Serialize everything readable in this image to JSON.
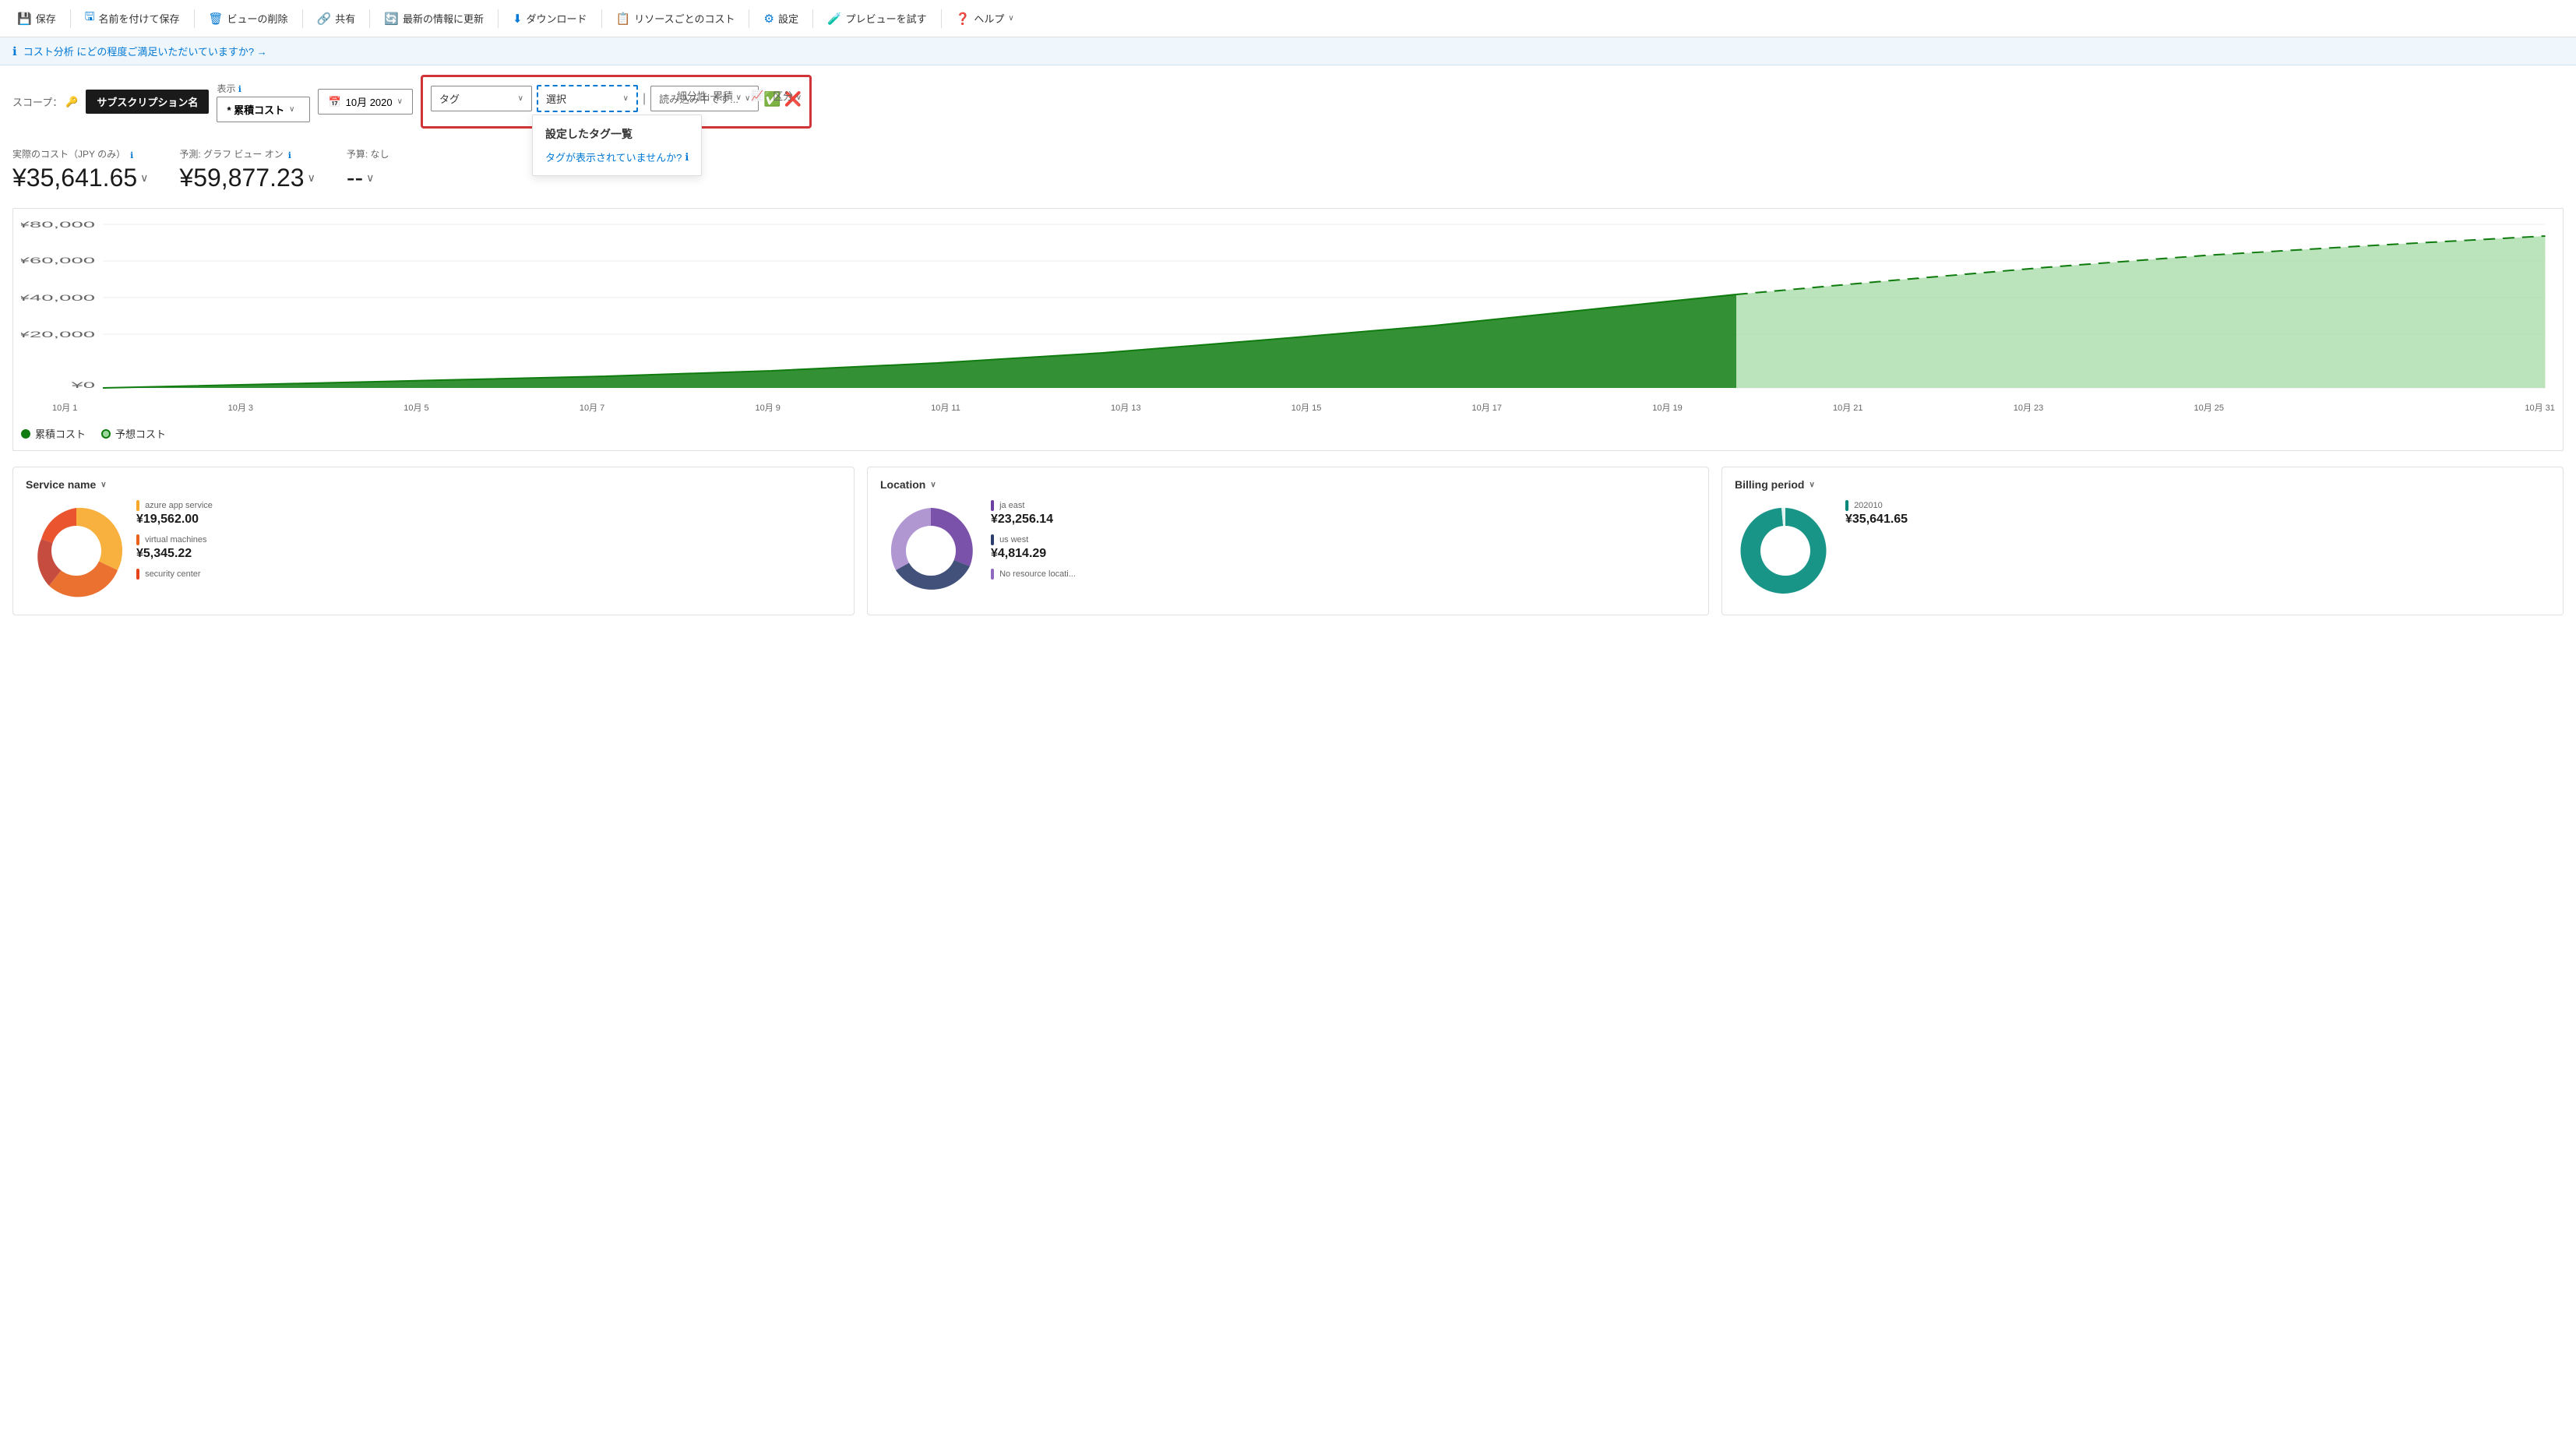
{
  "toolbar": {
    "buttons": [
      {
        "id": "save",
        "label": "保存",
        "icon": "💾"
      },
      {
        "id": "save-as",
        "label": "名前を付けて保存",
        "icon": "🖫"
      },
      {
        "id": "delete-view",
        "label": "ビューの削除",
        "icon": "🗑"
      },
      {
        "id": "share",
        "label": "共有",
        "icon": "🔗"
      },
      {
        "id": "refresh",
        "label": "最新の情報に更新",
        "icon": "🔄"
      },
      {
        "id": "download",
        "label": "ダウンロード",
        "icon": "⬇"
      },
      {
        "id": "resource-cost",
        "label": "リソースごとのコスト",
        "icon": "📋"
      },
      {
        "id": "settings",
        "label": "設定",
        "icon": "⚙"
      },
      {
        "id": "preview",
        "label": "プレビューを試す",
        "icon": "🧪"
      },
      {
        "id": "help",
        "label": "ヘルプ",
        "icon": "❓"
      }
    ]
  },
  "infobar": {
    "text": "コスト分析 にどの程度ご満足いただいていますか? →"
  },
  "scope": {
    "label": "スコープ：",
    "value": "サブスクリプション名"
  },
  "display": {
    "label": "表示",
    "sublabel": "* 累積コスト",
    "chevron": "∨"
  },
  "date": {
    "label": "10月 2020",
    "icon": "📅"
  },
  "filter": {
    "tag_dropdown": {
      "label": "タグ",
      "chevron": "∨"
    },
    "select_dropdown": {
      "label": "選択",
      "chevron": "∨"
    },
    "loading_dropdown": {
      "label": "読み込み中です...",
      "chevron": "∨"
    },
    "panel": {
      "title": "設定したタグ一覧",
      "link": "タグが表示されていませんか?",
      "info_icon": "ℹ"
    }
  },
  "right_controls": {
    "granularity_label": "細分性: 累積",
    "chart_type_label": "区分"
  },
  "metrics": [
    {
      "id": "actual",
      "label": "実際のコスト（JPY のみ）",
      "has_info": true,
      "value": "¥35,641.65",
      "has_chevron": true
    },
    {
      "id": "forecast",
      "label": "予測: グラフ ビュー オン",
      "has_info": true,
      "value": "¥59,877.23",
      "has_chevron": true
    },
    {
      "id": "budget",
      "label": "予算: なし",
      "value": "--",
      "has_chevron": true
    }
  ],
  "chart": {
    "y_labels": [
      "¥80,000",
      "¥60,000",
      "¥40,000",
      "¥20,000",
      "¥0"
    ],
    "x_labels": [
      "10月 1",
      "10月 3",
      "10月 5",
      "10月 7",
      "10月 9",
      "10月 11",
      "10月 13",
      "10月 15",
      "10月 17",
      "10月 19",
      "10月 21",
      "10月 23",
      "10月 25",
      "",
      "10月 31"
    ]
  },
  "legend": [
    {
      "id": "actual",
      "label": "累積コスト",
      "type": "actual"
    },
    {
      "id": "forecast",
      "label": "予想コスト",
      "type": "forecast"
    }
  ],
  "cards": [
    {
      "id": "service-name",
      "title": "Service name",
      "items": [
        {
          "name": "azure app service",
          "value": "¥19,562.00",
          "color": "#f7a829"
        },
        {
          "name": "virtual machines",
          "value": "¥5,345.22",
          "color": "#e8621a"
        },
        {
          "name": "security center",
          "value": "",
          "color": "#e8421a"
        }
      ],
      "donut_colors": [
        "#f7a829",
        "#e8621a",
        "#e8421a",
        "#c0392b"
      ]
    },
    {
      "id": "location",
      "title": "Location",
      "items": [
        {
          "name": "ja east",
          "value": "¥23,256.14",
          "color": "#6b3fa0"
        },
        {
          "name": "us west",
          "value": "¥4,814.29",
          "color": "#2c3e6b"
        },
        {
          "name": "No resource locati...",
          "value": "",
          "color": "#7b5ea7"
        }
      ],
      "donut_colors": [
        "#6b3fa0",
        "#2c3e6b",
        "#8e6bbf"
      ]
    },
    {
      "id": "billing-period",
      "title": "Billing period",
      "items": [
        {
          "name": "202010",
          "value": "¥35,641.65",
          "color": "#00897b"
        }
      ],
      "donut_colors": [
        "#00897b",
        "#e0f2f1"
      ]
    }
  ]
}
